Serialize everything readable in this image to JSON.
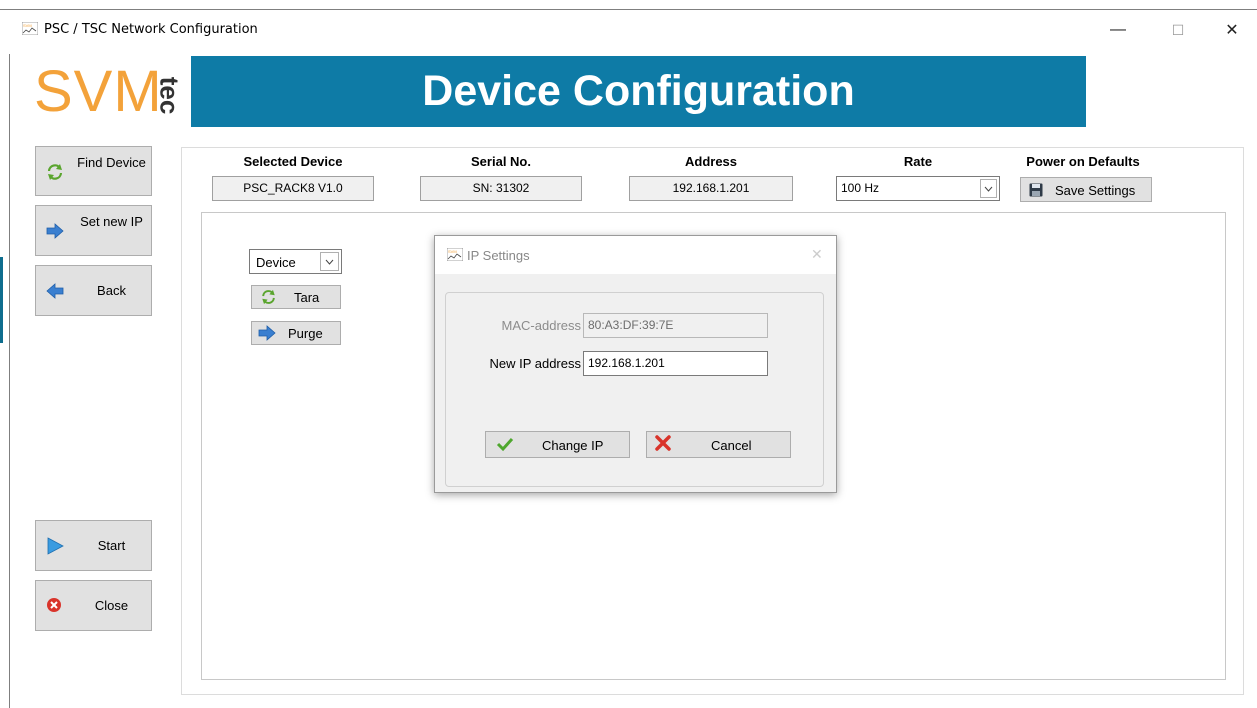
{
  "window": {
    "title": "PSC / TSC Network Configuration",
    "minimize_glyph": "—",
    "maximize_glyph": "☐",
    "close_glyph": "✕"
  },
  "header": {
    "logo_text": "SVM",
    "logo_suffix": "tec",
    "banner_title": "Device Configuration",
    "logo_color": "#f3a23a",
    "banner_color": "#0e7ba6"
  },
  "nav": {
    "find_device": "Find Device",
    "set_new_ip": "Set new IP",
    "back": "Back",
    "start": "Start",
    "close": "Close"
  },
  "fields": {
    "selected_device_label": "Selected Device",
    "selected_device_value": "PSC_RACK8 V1.0",
    "serial_label": "Serial No.",
    "serial_value": "SN: 31302",
    "address_label": "Address",
    "address_value": "192.168.1.201",
    "rate_label": "Rate",
    "rate_value": "100 Hz",
    "power_label": "Power on Defaults",
    "save_settings": "Save Settings"
  },
  "panel": {
    "device_select": "Device",
    "tara": "Tara",
    "purge": "Purge"
  },
  "dialog": {
    "title": "IP Settings",
    "mac_label": "MAC-address",
    "mac_value": "80:A3:DF:39:7E",
    "ip_label": "New IP address",
    "ip_value": "192.168.1.201",
    "change_ip": "Change IP",
    "cancel": "Cancel",
    "close_glyph": "✕"
  }
}
